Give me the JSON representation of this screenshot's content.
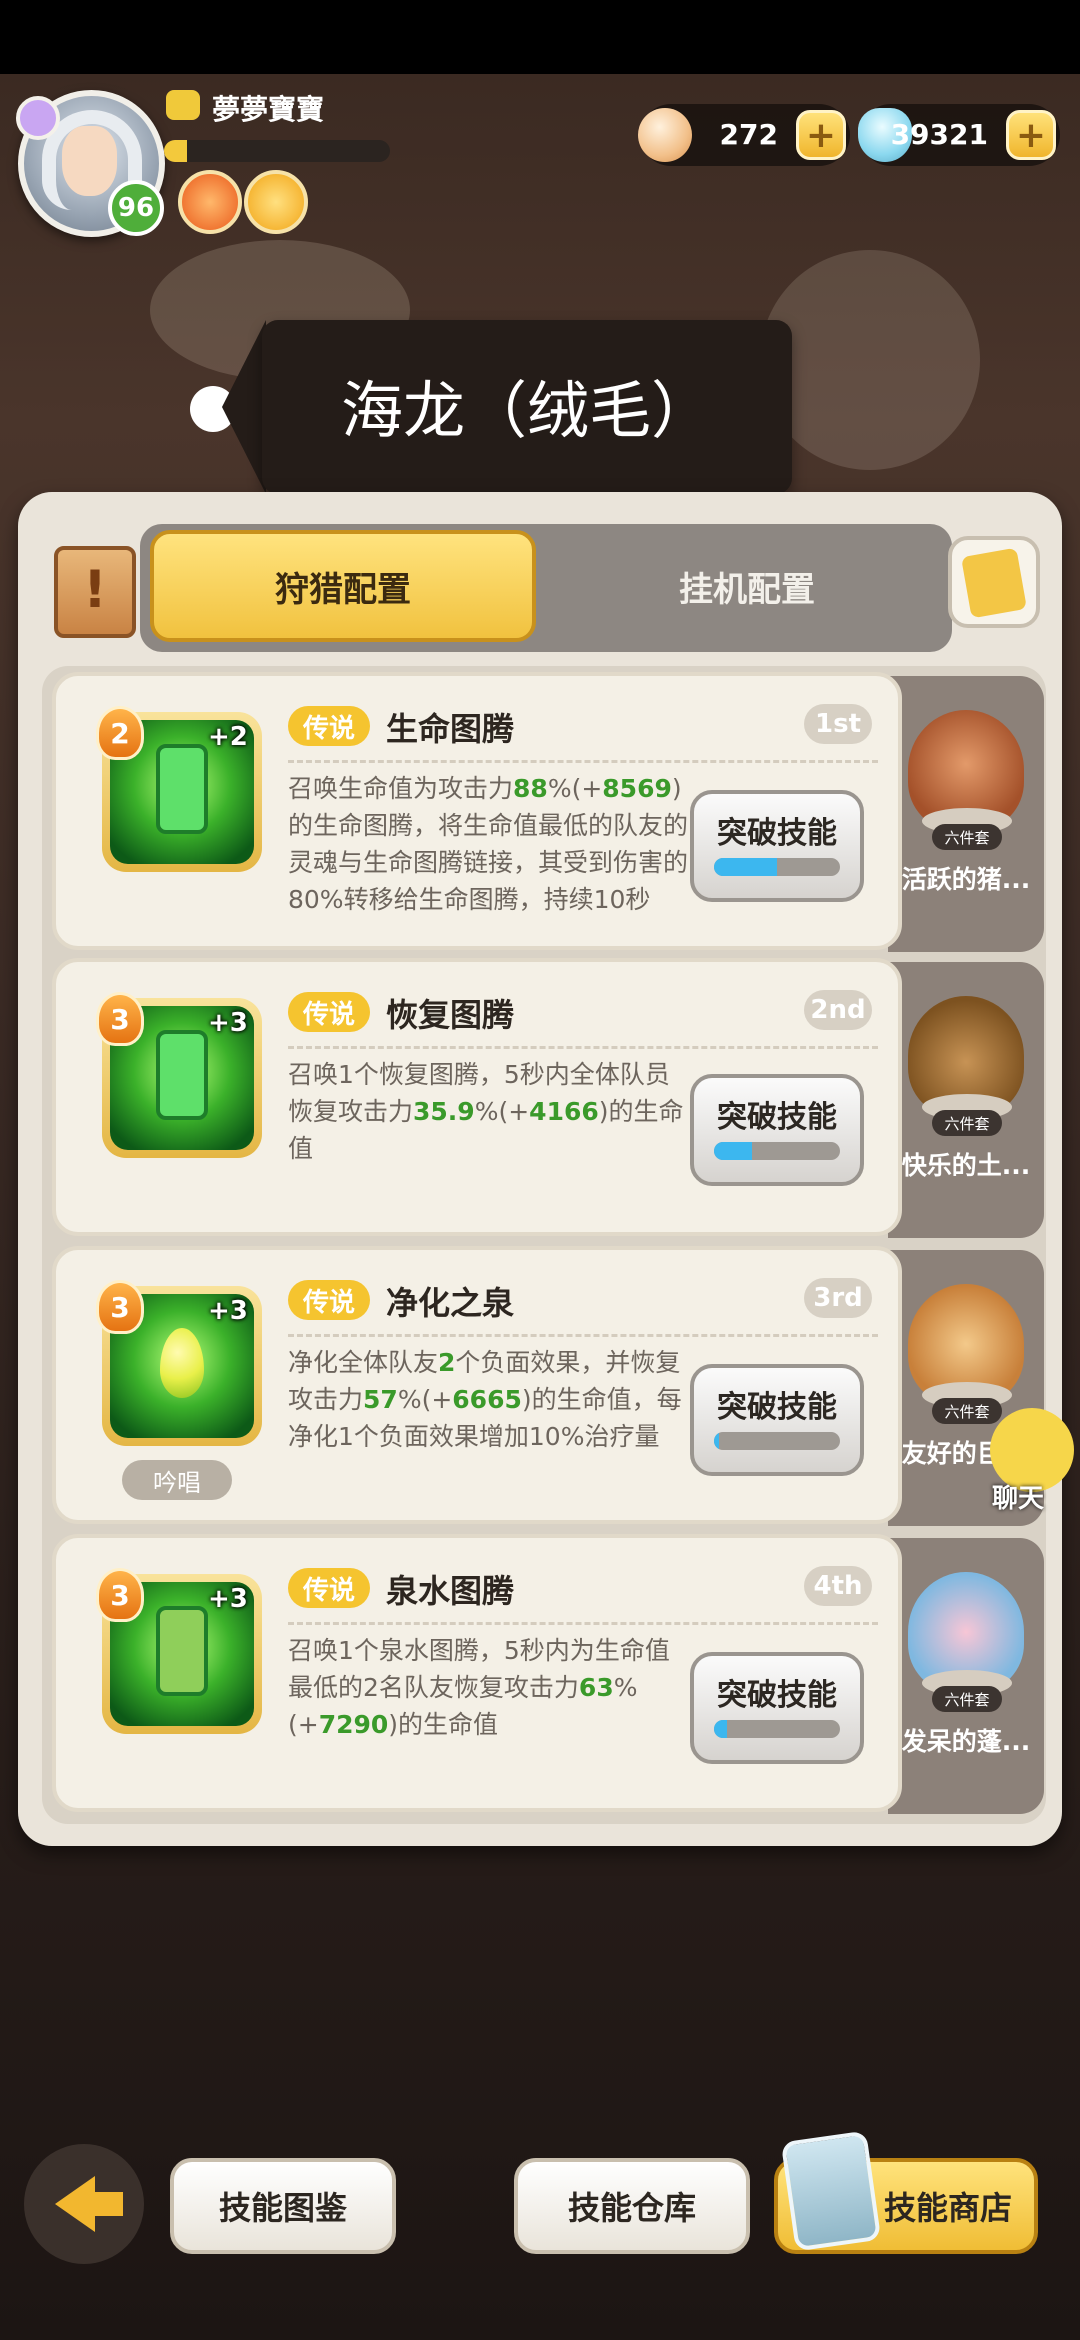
{
  "player": {
    "name": "夢夢寶寶",
    "level": "96",
    "exp_fraction": 0.1
  },
  "currencies": [
    {
      "icon": "shell-icon",
      "value": "272",
      "add": "+"
    },
    {
      "icon": "diamond-icon",
      "value": "39321",
      "add": "+"
    }
  ],
  "title": "海龙（绒毛）",
  "tabs": {
    "hunt": "狩猎配置",
    "idle": "挂机配置"
  },
  "skills": [
    {
      "level": "2",
      "plus": "+2",
      "rarity": "传说",
      "name": "生命图腾",
      "order": "1st",
      "desc": [
        "召唤生命值为攻击力",
        "88",
        "%(+",
        "8569",
        ")的生命图腾，将生命值最低的队友的灵魂与生命图腾链接，其受到伤害的80%转移给生命图腾，持续10秒"
      ],
      "break_label": "突破技能",
      "break_progress": 0.5,
      "pet_name": "活跃的猪...",
      "set_tag": "六件套"
    },
    {
      "level": "3",
      "plus": "+3",
      "rarity": "传说",
      "name": "恢复图腾",
      "order": "2nd",
      "desc": [
        "召唤1个恢复图腾，5秒内全体队员恢复攻击力",
        "35.9",
        "%(+",
        "4166",
        ")的生命值"
      ],
      "break_label": "突破技能",
      "break_progress": 0.3,
      "pet_name": "快乐的土...",
      "set_tag": "六件套"
    },
    {
      "level": "3",
      "plus": "+3",
      "rarity": "传说",
      "name": "净化之泉",
      "order": "3rd",
      "chant": "吟唱",
      "desc": [
        "净化全体队友",
        "2",
        "个负面效果，并恢复攻击力",
        "57",
        "%(+",
        "6665",
        ")的生命值，每净化1个负面效果增加10%治疗量"
      ],
      "break_label": "突破技能",
      "break_progress": 0.03,
      "pet_name": "友好的巨...",
      "set_tag": "六件套"
    },
    {
      "level": "3",
      "plus": "+3",
      "rarity": "传说",
      "name": "泉水图腾",
      "order": "4th",
      "desc": [
        "召唤1个泉水图腾，5秒内为生命值最低的2名队友恢复攻击力",
        "63",
        "%(+",
        "7290",
        ")的生命值"
      ],
      "break_label": "突破技能",
      "break_progress": 0.1,
      "pet_name": "发呆的蓬...",
      "set_tag": "六件套"
    }
  ],
  "chat": {
    "label": "聊天"
  },
  "bottom": {
    "codex": "技能图鉴",
    "storage": "技能仓库",
    "shop": "技能商店"
  },
  "colors": {
    "accent": "#f1c23f",
    "highlight_green": "#3a9a2a",
    "progress": "#3cb7ef"
  }
}
